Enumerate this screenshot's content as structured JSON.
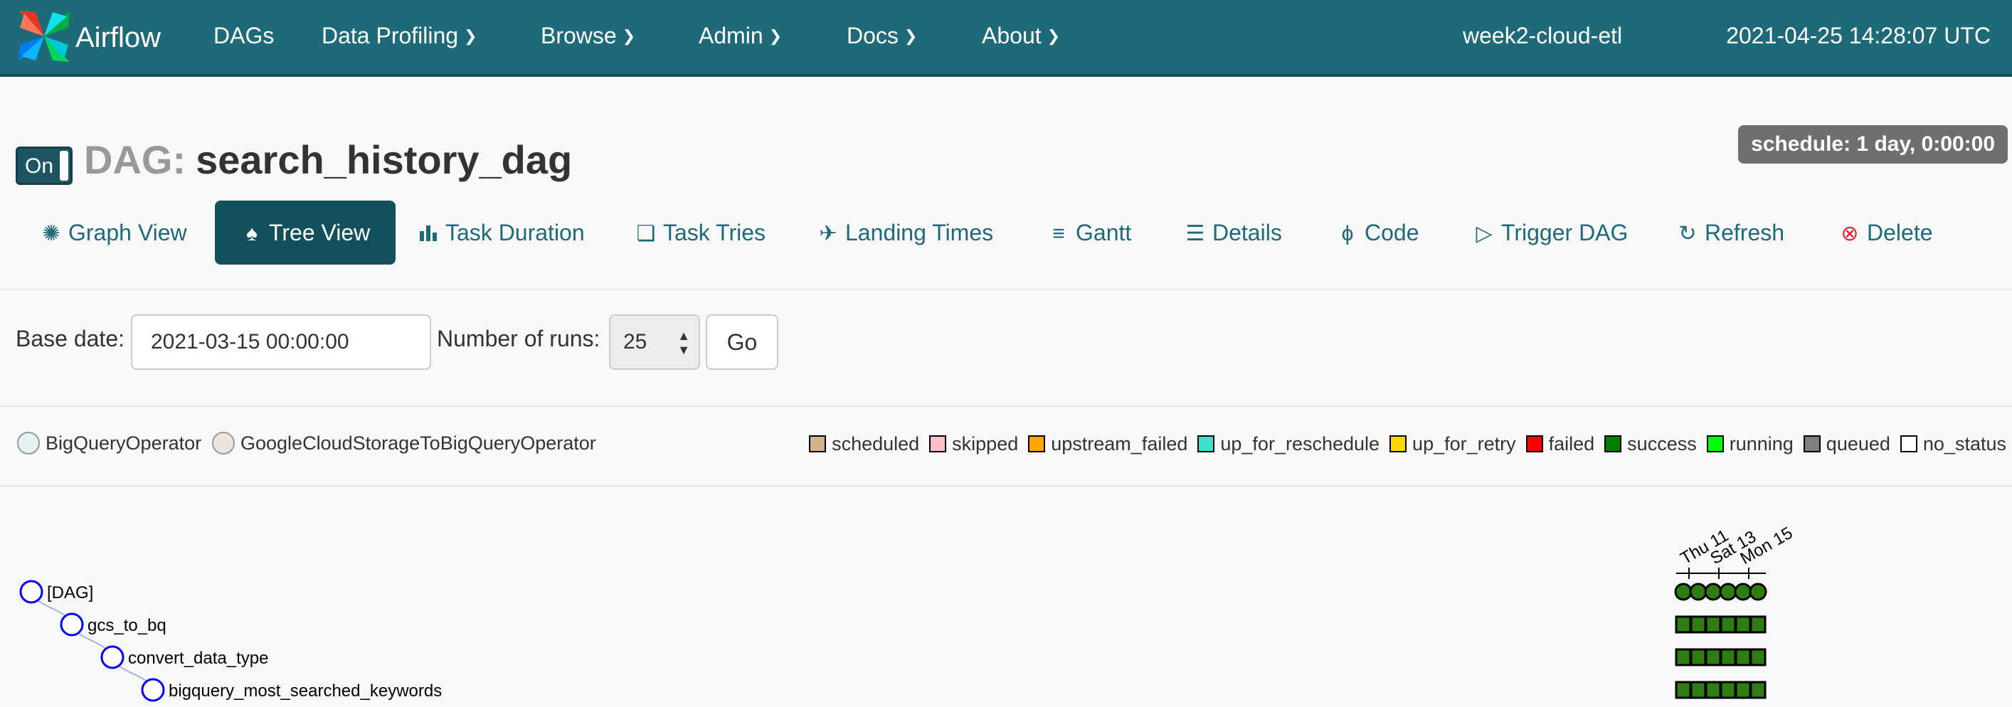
{
  "navbar": {
    "brand": "Airflow",
    "items": [
      {
        "label": "DAGs",
        "dropdown": false
      },
      {
        "label": "Data Profiling",
        "dropdown": true
      },
      {
        "label": "Browse",
        "dropdown": true
      },
      {
        "label": "Admin",
        "dropdown": true
      },
      {
        "label": "Docs",
        "dropdown": true
      },
      {
        "label": "About",
        "dropdown": true
      }
    ],
    "environment": "week2-cloud-etl",
    "clock": "2021-04-25 14:28:07 UTC"
  },
  "dag": {
    "toggle_label": "On",
    "prefix": "DAG:",
    "id": "search_history_dag",
    "schedule": "schedule: 1 day, 0:00:00"
  },
  "tabs": [
    {
      "label": "Graph View",
      "icon": "graph-icon"
    },
    {
      "label": "Tree View",
      "icon": "tree-icon",
      "active": true
    },
    {
      "label": "Task Duration",
      "icon": "bar-chart-icon"
    },
    {
      "label": "Task Tries",
      "icon": "copy-icon"
    },
    {
      "label": "Landing Times",
      "icon": "plane-icon"
    },
    {
      "label": "Gantt",
      "icon": "align-left-icon"
    },
    {
      "label": "Details",
      "icon": "list-icon"
    },
    {
      "label": "Code",
      "icon": "bolt-icon"
    },
    {
      "label": "Trigger DAG",
      "icon": "play-circle-icon"
    },
    {
      "label": "Refresh",
      "icon": "refresh-icon"
    },
    {
      "label": "Delete",
      "icon": "delete-circle-icon"
    }
  ],
  "form": {
    "base_date_label": "Base date:",
    "base_date_value": "2021-03-15 00:00:00",
    "runs_label": "Number of runs:",
    "runs_value": "25",
    "go_label": "Go"
  },
  "operators": [
    {
      "name": "BigQueryOperator",
      "color": "#e6f1f2"
    },
    {
      "name": "GoogleCloudStorageToBigQueryOperator",
      "color": "#ebe6dc"
    }
  ],
  "states": [
    {
      "name": "scheduled",
      "color": "#d2b48c"
    },
    {
      "name": "skipped",
      "color": "#ffc0cb"
    },
    {
      "name": "upstream_failed",
      "color": "#ffa500"
    },
    {
      "name": "up_for_reschedule",
      "color": "#40e0d0"
    },
    {
      "name": "up_for_retry",
      "color": "#ffd700"
    },
    {
      "name": "failed",
      "color": "#ff0000"
    },
    {
      "name": "success",
      "color": "#008000"
    },
    {
      "name": "running",
      "color": "#00ff00"
    },
    {
      "name": "queued",
      "color": "#808080"
    },
    {
      "name": "no_status",
      "color": "#ffffff"
    }
  ],
  "tree": {
    "date_ticks": [
      "Thu 11",
      "Sat 13",
      "Mon 15"
    ],
    "nodes": [
      {
        "label": "[DAG]",
        "depth": 0,
        "kind": "dag"
      },
      {
        "label": "gcs_to_bq",
        "depth": 1,
        "kind": "task"
      },
      {
        "label": "convert_data_type",
        "depth": 2,
        "kind": "task"
      },
      {
        "label": "bigquery_most_searched_keywords",
        "depth": 3,
        "kind": "task"
      }
    ],
    "run_count": 6,
    "run_state": "success"
  },
  "colors": {
    "navbar": "#1e6a78",
    "accent": "#1e6a78",
    "active_tab": "#14505b",
    "success_fill": "#2e7d13",
    "tree_stroke": "#0000ff"
  }
}
